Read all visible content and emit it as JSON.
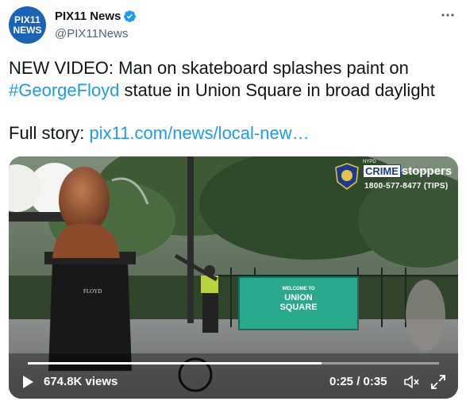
{
  "account": {
    "avatar_line1": "PIX11",
    "avatar_line2": "NEWS",
    "display_name": "PIX11 News",
    "handle": "@PIX11News",
    "verified_icon": "verified-badge-icon",
    "more_icon": "more-options-icon"
  },
  "tweet": {
    "line1": "NEW VIDEO: Man on skateboard splashes paint on",
    "hashtag": "#GeorgeFloyd",
    "line2_rest": " statue in Union Square in broad daylight",
    "full_story_label": "Full story: ",
    "link_text": "pix11.com/news/local-new…"
  },
  "video": {
    "overlay": {
      "nypd_small": "NYPD",
      "crime": "CRIME",
      "stoppers": "stoppers",
      "phone": "1800-577-8477 (TIPS)"
    },
    "sign_line1": "WELCOME TO",
    "sign_line2": "UNION",
    "sign_line3": "SQUARE",
    "plaque": "FLOYD",
    "views": "674.8K views",
    "time": "0:25 / 0:35",
    "progress": 0.714,
    "colors": {
      "accent": "#1d9bf0",
      "brand": "#1b63b5"
    }
  }
}
